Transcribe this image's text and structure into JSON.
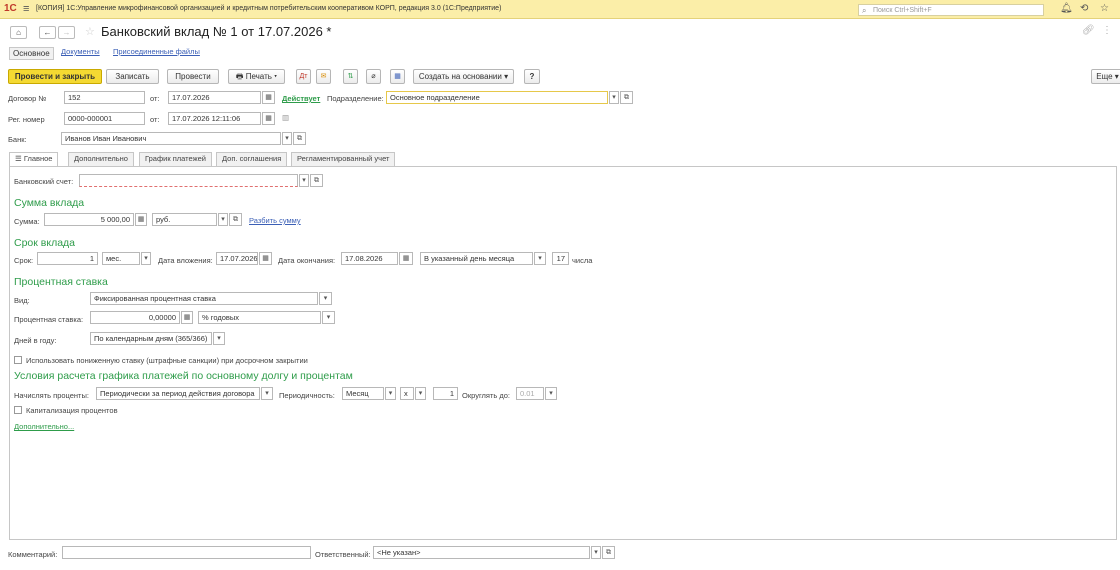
{
  "titlebar": {
    "logo": "1С",
    "title": "[КОПИЯ] 1С:Управление микрофинансовой организацией и кредитным потребительским кооперативом КОРП, редакция 3.0  (1С:Предприятие)",
    "search_placeholder": "Поиск Ctrl+Shift+F"
  },
  "doc": {
    "title": "Банковский вклад № 1 от 17.07.2026 *"
  },
  "subtabs": [
    "Основное",
    "Документы",
    "Присоединенные файлы"
  ],
  "toolbar": {
    "post_close": "Провести и закрыть",
    "save": "Записать",
    "post": "Провести",
    "print": "Печать",
    "create_based": "Создать на основании",
    "help": "?",
    "more": "Еще"
  },
  "header": {
    "contract_label": "Договор №",
    "contract_value": "152",
    "from_label": "от:",
    "contract_date": "17.07.2026",
    "status_link": "Действует",
    "division_label": "Подразделение:",
    "division_value": "Основное подразделение",
    "reg_label": "Рег. номер",
    "reg_value": "0000-000001",
    "reg_from_label": "от:",
    "reg_date": "17.07.2026 12:11:06",
    "bank_label": "Банк:",
    "bank_value": "Иванов Иван Иванович"
  },
  "tabs": [
    "Главное",
    "Дополнительно",
    "График платежей",
    "Доп. соглашения",
    "Регламентированный учет"
  ],
  "main": {
    "account_label": "Банковский счет:",
    "account_value": "",
    "sum_section": "Сумма вклада",
    "sum_label": "Сумма:",
    "sum_value": "5 000,00",
    "currency": "руб.",
    "split_link": "Разбить сумму",
    "term_section": "Срок вклада",
    "term_label": "Срок:",
    "term_value": "1",
    "term_unit": "мес.",
    "placement_label": "Дата вложения:",
    "placement_date": "17.07.2026",
    "end_label": "Дата окончания:",
    "end_date": "17.08.2026",
    "day_mode": "В указанный день месяца",
    "day_value": "17",
    "day_suffix": "числа",
    "rate_section": "Процентная ставка",
    "kind_label": "Вид:",
    "kind_value": "Фиксированная процентная ставка",
    "rate_label": "Процентная ставка:",
    "rate_value": "0,00000",
    "rate_unit": "% годовых",
    "days_label": "Дней в году:",
    "days_value": "По календарным дням (365/366)",
    "penalty_label": "Использовать пониженную ставку (штрафные санкции) при досрочном закрытии",
    "schedule_section": "Условия расчета графика платежей по основному долгу и процентам",
    "accrue_label": "Начислять проценты:",
    "accrue_value": "Периодически за период действия договора",
    "period_label": "Периодичность:",
    "period_value": "Месяц",
    "x_label": "х",
    "period_count": "1",
    "round_label": "Округлять до:",
    "round_value": "0.01",
    "cap_label": "Капитализация процентов",
    "more_link": "Дополнительно..."
  },
  "footer": {
    "comment_label": "Комментарий:",
    "comment_value": "",
    "resp_label": "Ответственный:",
    "resp_value": "<Не указан>"
  }
}
